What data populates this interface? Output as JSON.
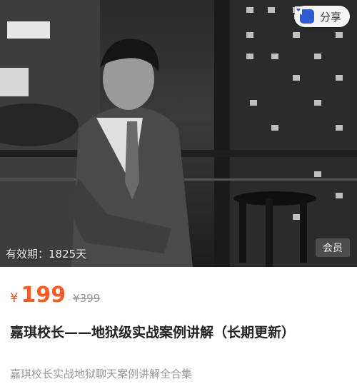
{
  "share": {
    "label": "分享"
  },
  "hero": {
    "validity": "有效期：1825天",
    "member_badge": "会员"
  },
  "product": {
    "price_symbol": "¥",
    "price": "199",
    "original_price": "¥399",
    "title": "嘉琪校长——地狱级实战案例讲解（长期更新）",
    "subtitle": "嘉琪校长实战地狱聊天案例讲解全合集"
  },
  "colors": {
    "price": "#ff5a1f",
    "share_icon": "#2f5bd6"
  }
}
